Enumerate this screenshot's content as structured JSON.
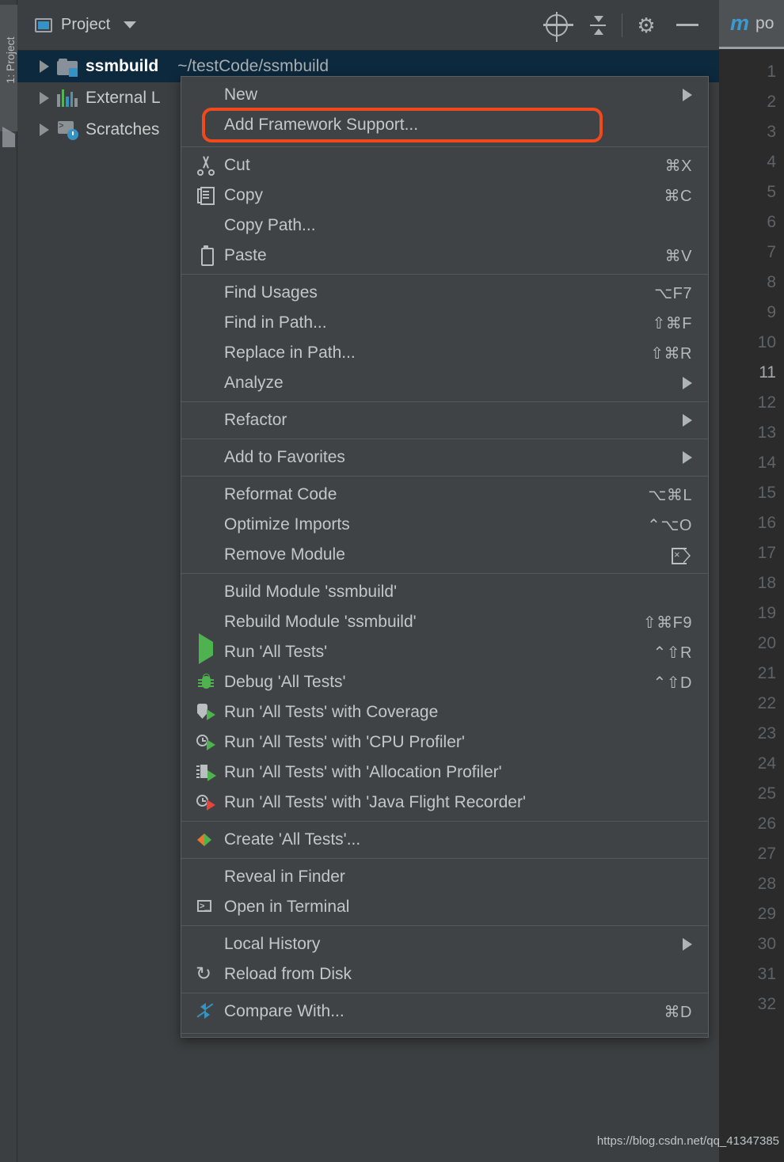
{
  "toolwindow": {
    "vertical_label": "1: Project",
    "title": "Project",
    "icons": {
      "project_icon": "project-icon",
      "dropdown": "chevron-down-icon",
      "locate": "target-icon",
      "collapse_all": "collapse-all-icon",
      "settings": "gear-icon",
      "hide": "minimize-icon"
    }
  },
  "tree": {
    "items": [
      {
        "name": "ssmbuild",
        "path": "~/testCode/ssmbuild",
        "icon": "module-folder-icon",
        "selected": true,
        "bold": true
      },
      {
        "name": "External L",
        "path": "",
        "icon": "library-icon",
        "selected": false,
        "bold": false
      },
      {
        "name": "Scratches",
        "path": "",
        "icon": "scratches-icon",
        "selected": false,
        "bold": false
      }
    ]
  },
  "context_menu": {
    "highlight_color": "#f0491e",
    "highlighted_item": "Add Framework Support...",
    "groups": [
      {
        "items": [
          {
            "label": "New",
            "shortcut": "",
            "icon": "",
            "submenu": true
          },
          {
            "label": "Add Framework Support...",
            "shortcut": "",
            "icon": "",
            "submenu": false,
            "highlighted": true
          }
        ]
      },
      {
        "items": [
          {
            "label": "Cut",
            "shortcut": "⌘X",
            "icon": "cut-icon",
            "submenu": false
          },
          {
            "label": "Copy",
            "shortcut": "⌘C",
            "icon": "copy-icon",
            "submenu": false
          },
          {
            "label": "Copy Path...",
            "shortcut": "",
            "icon": "",
            "submenu": false
          },
          {
            "label": "Paste",
            "shortcut": "⌘V",
            "icon": "paste-icon",
            "submenu": false
          }
        ]
      },
      {
        "items": [
          {
            "label": "Find Usages",
            "shortcut": "⌥F7",
            "icon": "",
            "submenu": false
          },
          {
            "label": "Find in Path...",
            "shortcut": "⇧⌘F",
            "icon": "",
            "submenu": false
          },
          {
            "label": "Replace in Path...",
            "shortcut": "⇧⌘R",
            "icon": "",
            "submenu": false
          },
          {
            "label": "Analyze",
            "shortcut": "",
            "icon": "",
            "submenu": true
          }
        ]
      },
      {
        "items": [
          {
            "label": "Refactor",
            "shortcut": "",
            "icon": "",
            "submenu": true
          }
        ]
      },
      {
        "items": [
          {
            "label": "Add to Favorites",
            "shortcut": "",
            "icon": "",
            "submenu": true
          }
        ]
      },
      {
        "items": [
          {
            "label": "Reformat Code",
            "shortcut": "⌥⌘L",
            "icon": "",
            "submenu": false
          },
          {
            "label": "Optimize Imports",
            "shortcut": "⌃⌥O",
            "icon": "",
            "submenu": false
          },
          {
            "label": "Remove Module",
            "shortcut": "",
            "icon": "delete-key-icon",
            "submenu": false,
            "key_icon": true
          }
        ]
      },
      {
        "items": [
          {
            "label": "Build Module 'ssmbuild'",
            "shortcut": "",
            "icon": "",
            "submenu": false
          },
          {
            "label": "Rebuild Module 'ssmbuild'",
            "shortcut": "⇧⌘F9",
            "icon": "",
            "submenu": false
          },
          {
            "label": "Run 'All Tests'",
            "shortcut": "⌃⇧R",
            "icon": "run-icon",
            "submenu": false
          },
          {
            "label": "Debug 'All Tests'",
            "shortcut": "⌃⇧D",
            "icon": "debug-icon",
            "submenu": false
          },
          {
            "label": "Run 'All Tests' with Coverage",
            "shortcut": "",
            "icon": "coverage-icon",
            "submenu": false
          },
          {
            "label": "Run 'All Tests' with 'CPU Profiler'",
            "shortcut": "",
            "icon": "cpu-profiler-icon",
            "submenu": false
          },
          {
            "label": "Run 'All Tests' with 'Allocation Profiler'",
            "shortcut": "",
            "icon": "allocation-profiler-icon",
            "submenu": false
          },
          {
            "label": "Run 'All Tests' with 'Java Flight Recorder'",
            "shortcut": "",
            "icon": "flight-recorder-icon",
            "submenu": false
          }
        ]
      },
      {
        "items": [
          {
            "label": "Create 'All Tests'...",
            "shortcut": "",
            "icon": "create-run-config-icon",
            "submenu": false
          }
        ]
      },
      {
        "items": [
          {
            "label": "Reveal in Finder",
            "shortcut": "",
            "icon": "",
            "submenu": false
          },
          {
            "label": "Open in Terminal",
            "shortcut": "",
            "icon": "terminal-icon",
            "submenu": false
          }
        ]
      },
      {
        "items": [
          {
            "label": "Local History",
            "shortcut": "",
            "icon": "",
            "submenu": true
          },
          {
            "label": "Reload from Disk",
            "shortcut": "",
            "icon": "reload-icon",
            "submenu": false
          }
        ]
      },
      {
        "items": [
          {
            "label": "Compare With...",
            "shortcut": "⌘D",
            "icon": "compare-icon",
            "submenu": false
          }
        ]
      }
    ]
  },
  "editor": {
    "tab_icon": "m",
    "tab_title": "po",
    "current_line": 11,
    "line_numbers": [
      1,
      2,
      3,
      4,
      5,
      6,
      7,
      8,
      9,
      10,
      11,
      12,
      13,
      14,
      15,
      16,
      17,
      18,
      19,
      20,
      21,
      22,
      23,
      24,
      25,
      26,
      27,
      28,
      29,
      30,
      31,
      32
    ]
  },
  "watermark": "https://blog.csdn.net/qq_41347385"
}
